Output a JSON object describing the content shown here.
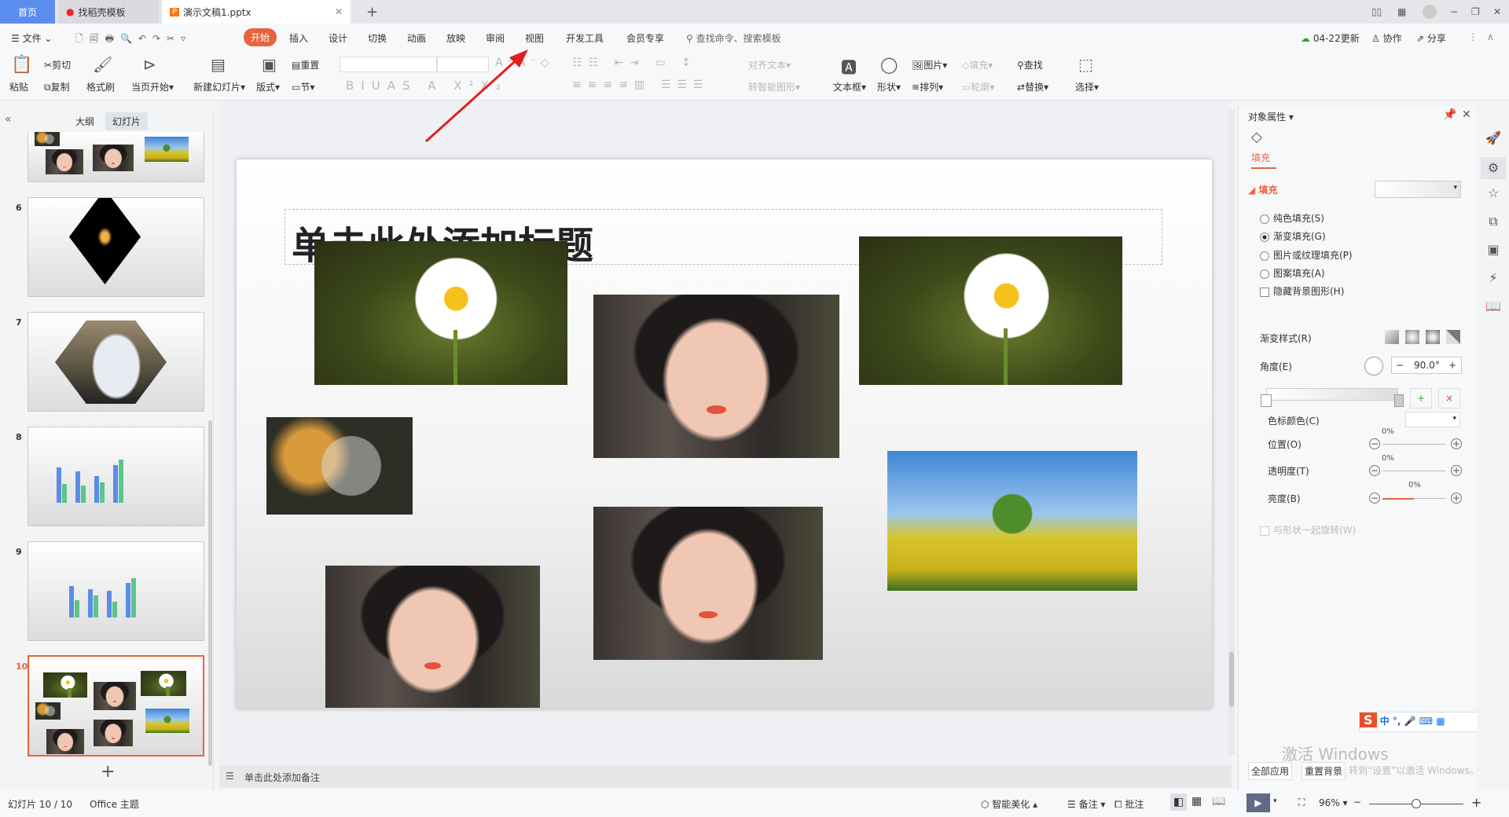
{
  "tabs": [
    {
      "label": "首页"
    },
    {
      "label": "找稻壳模板"
    },
    {
      "label": "演示文稿1.pptx"
    }
  ],
  "menu": {
    "file": "文件",
    "items": [
      "开始",
      "插入",
      "设计",
      "切换",
      "动画",
      "放映",
      "审阅",
      "视图",
      "开发工具",
      "会员专享"
    ],
    "search_placeholder": "查找命令、搜索模板",
    "update": "04-22更新",
    "collab": "协作",
    "share": "分享"
  },
  "ribbon": {
    "paste": "粘贴",
    "cut": "剪切",
    "copy": "复制",
    "format_painter": "格式刷",
    "from_current": "当页开始",
    "new_slide": "新建幻灯片",
    "layout": "版式",
    "reset": "重置",
    "section": "节",
    "align_text": "对齐文本",
    "smartart": "转智能图形",
    "textbox": "文本框",
    "shape": "形状",
    "picture": "图片",
    "fill": "填充",
    "arrange": "排列",
    "outline": "轮廓",
    "find": "查找",
    "replace": "替换",
    "select": "选择"
  },
  "left_panel": {
    "outline_tab": "大纲",
    "slides_tab": "幻灯片",
    "slide_numbers": [
      "6",
      "7",
      "8",
      "9",
      "10"
    ],
    "active_slide": 10
  },
  "slide": {
    "title_placeholder": "单击此处添加标题"
  },
  "notes": {
    "placeholder": "单击此处添加备注"
  },
  "status": {
    "slide_count": "幻灯片 10 / 10",
    "theme": "Office 主题",
    "beautify": "智能美化",
    "notes": "备注",
    "comment": "批注",
    "zoom": "96%"
  },
  "right_panel": {
    "title": "对象属性",
    "tab": "填充",
    "section": "填充",
    "options": [
      {
        "label": "纯色填充(S)",
        "selected": false
      },
      {
        "label": "渐变填充(G)",
        "selected": true
      },
      {
        "label": "图片或纹理填充(P)",
        "selected": false
      },
      {
        "label": "图案填充(A)",
        "selected": false
      }
    ],
    "hide_bg": "隐藏背景图形(H)",
    "gradient_style": "渐变样式(R)",
    "angle_label": "角度(E)",
    "angle_value": "90.0°",
    "stop_color": "色标颜色(C)",
    "position": "位置(O)",
    "position_value": "0%",
    "transparency": "透明度(T)",
    "transparency_value": "0%",
    "brightness": "亮度(B)",
    "brightness_value": "0%",
    "rotate_with_shape": "与形状一起旋转(W)"
  },
  "overlay": {
    "activate_title": "激活 Windows",
    "activate_sub": "转到“设置”以激活 Windows。",
    "apply_all": "全部应用",
    "reset_bg": "重置背景",
    "ime": "中"
  },
  "colors": {
    "accent": "#e8643c",
    "home_tab": "#5b8def",
    "arrow": "#e02020"
  }
}
